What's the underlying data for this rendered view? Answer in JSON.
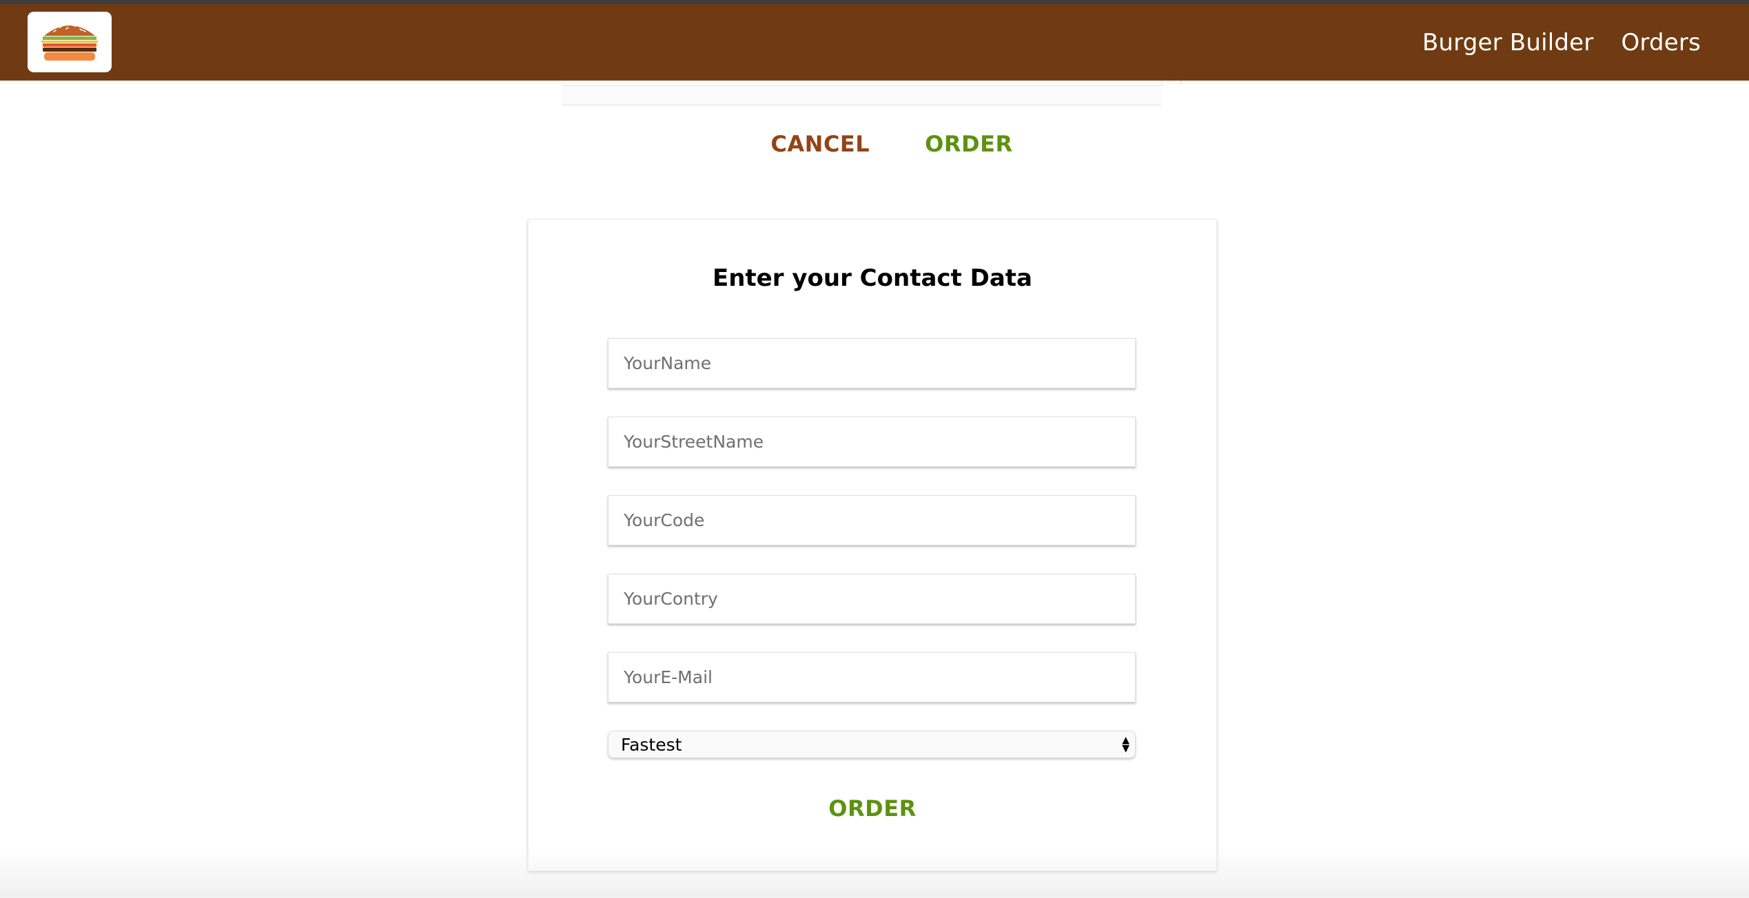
{
  "nav": {
    "logo_icon": "burger-logo-icon",
    "items": [
      {
        "label": "Burger Builder"
      },
      {
        "label": "Orders"
      }
    ]
  },
  "summary": {
    "cancel_label": "CANCEL",
    "order_label": "ORDER"
  },
  "contact": {
    "title": "Enter your Contact Data",
    "fields": [
      {
        "placeholder": "YourName",
        "value": ""
      },
      {
        "placeholder": "YourStreetName",
        "value": ""
      },
      {
        "placeholder": "YourCode",
        "value": ""
      },
      {
        "placeholder": "YourContry",
        "value": ""
      },
      {
        "placeholder": "YourE-Mail",
        "value": ""
      }
    ],
    "delivery": {
      "selected": "Fastest",
      "arrows_icon": "select-arrows-icon"
    },
    "order_label": "ORDER"
  },
  "colors": {
    "toolbar": "#703B12",
    "cancel": "#944317",
    "order": "#5C9210"
  }
}
